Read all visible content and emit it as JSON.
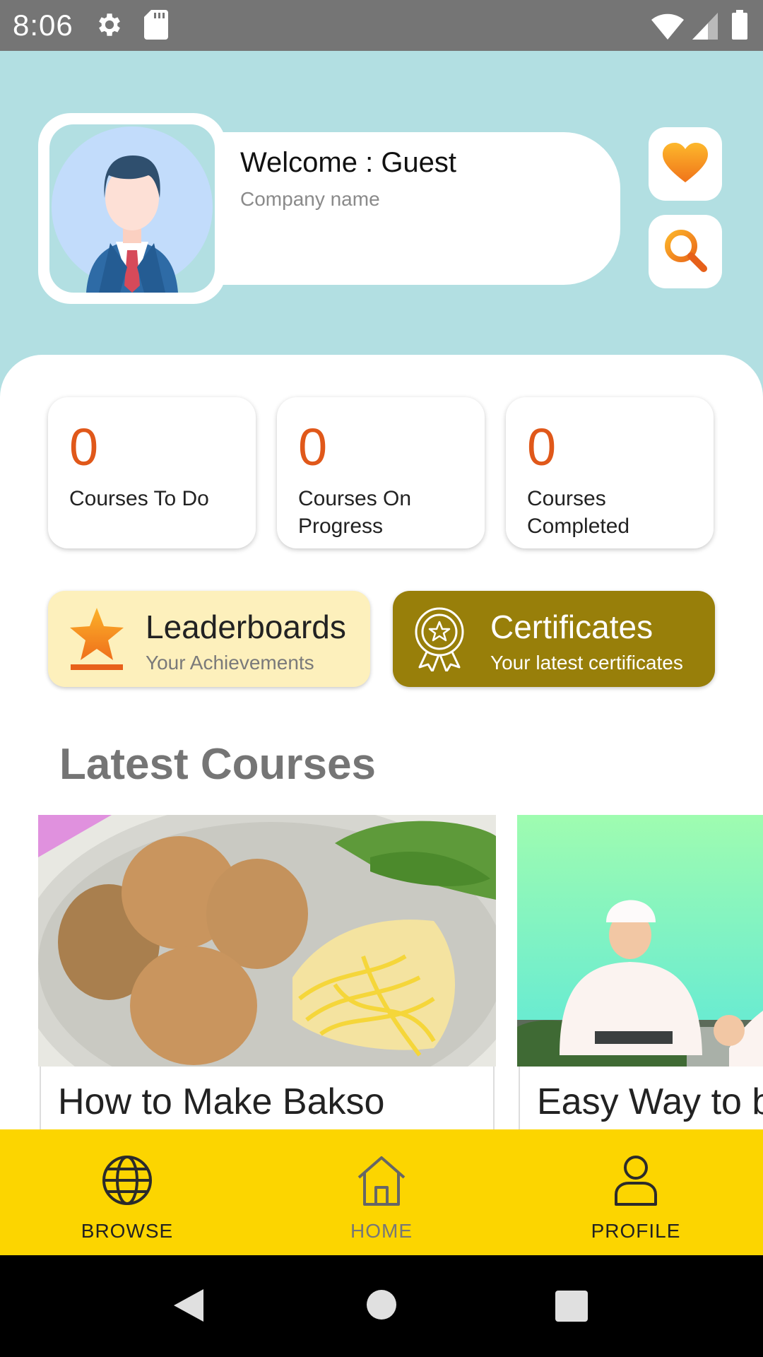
{
  "status_bar": {
    "time": "8:06",
    "icons": [
      "gear-icon",
      "sd-card-icon",
      "wifi-icon",
      "signal-icon",
      "battery-icon"
    ]
  },
  "header": {
    "welcome_text": "Welcome : Guest",
    "company_name": "Company name",
    "favorite_icon": "heart-icon",
    "search_icon": "search-icon"
  },
  "stats": [
    {
      "value": "0",
      "label": "Courses To Do"
    },
    {
      "value": "0",
      "label": "Courses On Progress"
    },
    {
      "value": "0",
      "label": "Courses Completed"
    }
  ],
  "actions": {
    "leaderboards": {
      "title": "Leaderboards",
      "subtitle": "Your Achievements",
      "icon": "star-icon"
    },
    "certificates": {
      "title": "Certificates",
      "subtitle": "Your latest certificates",
      "icon": "badge-icon"
    }
  },
  "latest_courses": {
    "title": "Latest Courses",
    "items": [
      {
        "title": "How to Make Bakso"
      },
      {
        "title": "Easy Way to b"
      }
    ]
  },
  "bottom_nav": {
    "items": [
      {
        "label": "BROWSE",
        "icon": "globe-icon",
        "active": false
      },
      {
        "label": "HOME",
        "icon": "home-icon",
        "active": true
      },
      {
        "label": "PROFILE",
        "icon": "user-icon",
        "active": false
      }
    ]
  },
  "system_nav": {
    "icons": [
      "back-icon",
      "home-circle-icon",
      "recents-icon"
    ]
  },
  "colors": {
    "header_bg": "#b2dfe2",
    "accent_orange": "#e0581a",
    "leaderboards_bg": "#fdf0bc",
    "certificates_bg": "#987f0a",
    "nav_bg": "#fcd500",
    "status_bar_bg": "#757575"
  }
}
